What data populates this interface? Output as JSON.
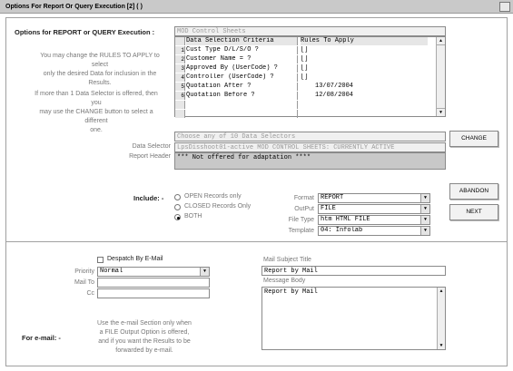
{
  "window": {
    "title": "Options For Report Or Query Execution [2]   ( )"
  },
  "options": {
    "heading": "Options for REPORT or QUERY Execution :",
    "help1_lines": [
      "You may change the RULES TO APPLY to select",
      "only the desired Data for inclusion in the",
      "Results."
    ],
    "help2_lines": [
      "If more than 1 Data Selector is offered, then you",
      "may use the CHANGE button to select a different",
      "one."
    ],
    "report_name": "MOD Control Sheets",
    "grid": {
      "headers": [
        "Data Selection Criteria",
        "Rules To Apply"
      ],
      "rows": [
        {
          "num": "1",
          "criteria": "Cust Type D/L/S/O ?",
          "rule": "[]"
        },
        {
          "num": "2",
          "criteria": "Customer Name = ?",
          "rule": "[]"
        },
        {
          "num": "3",
          "criteria": "Approved By (UserCode) ?",
          "rule": "[]"
        },
        {
          "num": "4",
          "criteria": "Controller (UserCode) ?",
          "rule": "[]"
        },
        {
          "num": "5",
          "criteria": "Quotation After ?",
          "rule": "13/07/2004"
        },
        {
          "num": "6",
          "criteria": "Quotation Before ?",
          "rule": "12/08/2004"
        }
      ]
    }
  },
  "selector": {
    "choose_text": "Choose any of 10 Data Selectors",
    "data_selector_label": "Data Selector",
    "data_selector_value": "LpsDisshoot01-active MOD CONTROL SHEETS: CURRENTLY ACTIVE",
    "report_header_label": "Report Header",
    "report_header_value": "*** Not offered for adaptation ****",
    "change_button": "CHANGE"
  },
  "include": {
    "label": "Include: -",
    "options": [
      "OPEN Records only",
      "CLOSED Records Only",
      "BOTH"
    ],
    "selected_index": 2
  },
  "output": {
    "format_label": "Format",
    "format_value": "REPORT",
    "output_label": "OutPut",
    "output_value": "FILE",
    "filetype_label": "File Type",
    "filetype_value": "htm HTML FILE",
    "template_label": "Template",
    "template_value": "04: Infolab"
  },
  "buttons": {
    "abandon": "ABANDON",
    "next": "NEXT"
  },
  "email": {
    "despatch_label": "Despatch By E-Mail",
    "despatch_checked": false,
    "priority_label": "Priority",
    "priority_value": "Normal",
    "mailto_label": "Mail To",
    "mailto_value": "",
    "cc_label": "Cc",
    "cc_value": "",
    "section_label": "For e-mail: -",
    "help_lines": [
      "Use the e-mail Section only when",
      "a FILE Output Option is offered,",
      "and if you want the Results to be",
      "forwarded by e-mail."
    ],
    "subject_label": "Mail Subject Title",
    "subject_value": "Report by Mail",
    "body_label": "Message Body",
    "body_value": "Report by Mail"
  }
}
